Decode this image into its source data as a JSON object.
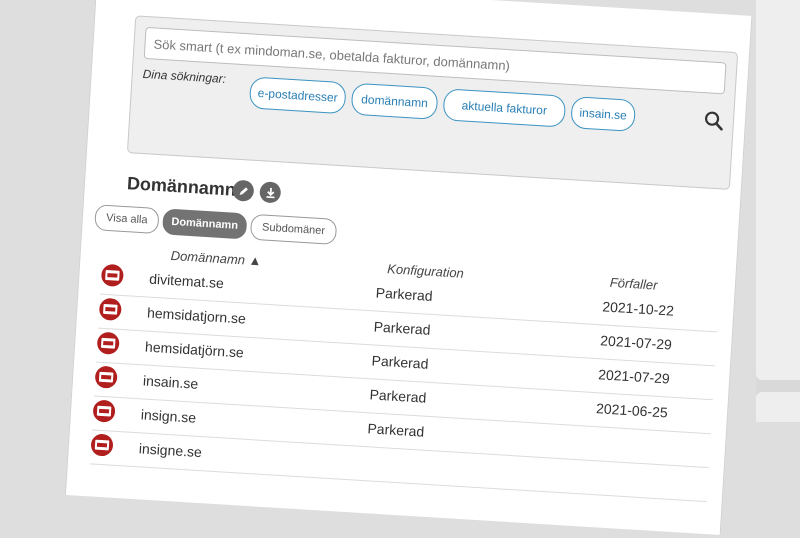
{
  "search": {
    "placeholder": "Sök smart (t ex mindoman.se, obetalda fakturor, domännamn)",
    "saved_label": "Dina sökningar:",
    "chips": [
      "e-postadresser",
      "domännamn",
      "aktuella fakturor",
      "insain.se"
    ]
  },
  "section": {
    "title": "Domännamn",
    "icons": [
      "edit-icon",
      "download-icon"
    ]
  },
  "filters": [
    {
      "label": "Visa alla",
      "active": false
    },
    {
      "label": "Domännamn",
      "active": true
    },
    {
      "label": "Subdomäner",
      "active": false
    }
  ],
  "table": {
    "headers": {
      "domain": "Domännamn ▲",
      "config": "Konfiguration",
      "expires": "Förfaller"
    },
    "rows": [
      {
        "domain": "divitemat.se",
        "config": "Parkerad",
        "expires": "2021-10-22"
      },
      {
        "domain": "hemsidatjorn.se",
        "config": "Parkerad",
        "expires": "2021-07-29"
      },
      {
        "domain": "hemsidatjörn.se",
        "config": "Parkerad",
        "expires": "2021-07-29"
      },
      {
        "domain": "insain.se",
        "config": "Parkerad",
        "expires": "2021-06-25"
      },
      {
        "domain": "insign.se",
        "config": "Parkerad",
        "expires": ""
      },
      {
        "domain": "insigne.se",
        "config": "",
        "expires": ""
      }
    ]
  },
  "colors": {
    "accent": "#3b93c2",
    "stamp": "#b01e1e",
    "active_filter": "#737373"
  }
}
